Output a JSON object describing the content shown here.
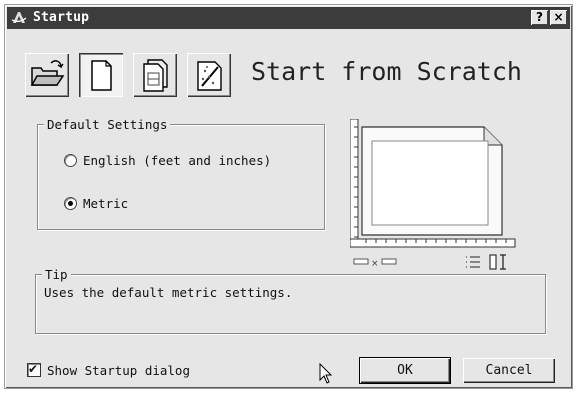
{
  "window": {
    "title": "Startup",
    "help_label": "?",
    "close_label": "×"
  },
  "toolbar": {
    "modes": [
      {
        "name": "Open a Drawing",
        "icon": "folder-open-icon",
        "active": false
      },
      {
        "name": "Start from Scratch",
        "icon": "blank-page-icon",
        "active": true
      },
      {
        "name": "Use a Template",
        "icon": "template-icon",
        "active": false
      },
      {
        "name": "Use a Wizard",
        "icon": "wizard-icon",
        "active": false
      }
    ]
  },
  "heading": "Start from Scratch",
  "default_settings": {
    "label": "Default Settings",
    "options": [
      {
        "label": "English (feet and inches)",
        "checked": false
      },
      {
        "label": "Metric",
        "checked": true
      }
    ]
  },
  "tip": {
    "label": "Tip",
    "text": "Uses the default metric settings."
  },
  "show_startup": {
    "label": "Show Startup dialog",
    "checked": true
  },
  "buttons": {
    "ok": "OK",
    "cancel": "Cancel"
  },
  "colors": {
    "dialog_bg": "#e6e6e6",
    "titlebar_bg": "#3c3c3c",
    "titlebar_text": "#ffffff"
  }
}
